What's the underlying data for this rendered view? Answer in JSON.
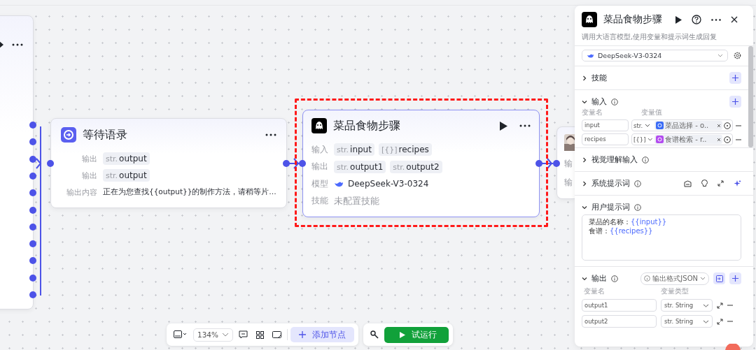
{
  "wait_node": {
    "title": "等待语录",
    "rows": [
      {
        "label": "输出",
        "type": "str.",
        "name": "output"
      },
      {
        "label": "输出",
        "type": "str.",
        "name": "output"
      }
    ],
    "content_label": "输出内容",
    "content": "正在为您查找{{output}}的制作方法，请稍等片…"
  },
  "llm_node": {
    "title": "菜品食物步骤",
    "highlighted": true,
    "input_label": "输入",
    "inputs": [
      {
        "type": "str.",
        "name": "input"
      },
      {
        "type": "[{}]",
        "name": "recipes"
      }
    ],
    "output_label": "输出",
    "outputs": [
      {
        "type": "str.",
        "name": "output1"
      },
      {
        "type": "str.",
        "name": "output2"
      }
    ],
    "model_label": "模型",
    "model": "DeepSeek-V3-0324",
    "skill_label": "技能",
    "skill": "未配置技能"
  },
  "next_node": {
    "labels": [
      "输",
      "输"
    ]
  },
  "panel": {
    "title": "菜品食物步骤",
    "description": "调用大语言模型,使用变量和提示词生成回复",
    "model": "DeepSeek-V3-0324",
    "skills": {
      "title": "技能",
      "expanded": false
    },
    "inputs": {
      "title": "输入",
      "expanded": true,
      "name_header": "变量名",
      "value_header": "变量值",
      "rows": [
        {
          "name": "input",
          "type": "str.",
          "ref": "菜品选择 - o..",
          "color": "#3b6cf6"
        },
        {
          "name": "recipes",
          "type": "[{}]",
          "ref": "食谱检索 - r..",
          "color": "#b34cf0"
        }
      ]
    },
    "vision": {
      "title": "视觉理解输入",
      "expanded": false
    },
    "system": {
      "title": "系统提示词",
      "expanded": false
    },
    "user": {
      "title": "用户提示词",
      "expanded": true,
      "lines": [
        {
          "text": "菜品的名称：",
          "var": "{{input}}"
        },
        {
          "text": "食谱：",
          "var": "{{recipes}}"
        }
      ]
    },
    "outputs": {
      "title": "输出",
      "expanded": true,
      "format": "输出格式JSON",
      "name_header": "变量名",
      "type_header": "变量类型",
      "rows": [
        {
          "name": "output1",
          "type": "str. String"
        },
        {
          "name": "output2",
          "type": "str. String"
        }
      ]
    }
  },
  "toolbar": {
    "zoom": "134%",
    "add_node": "添加节点",
    "run": "试运行"
  }
}
